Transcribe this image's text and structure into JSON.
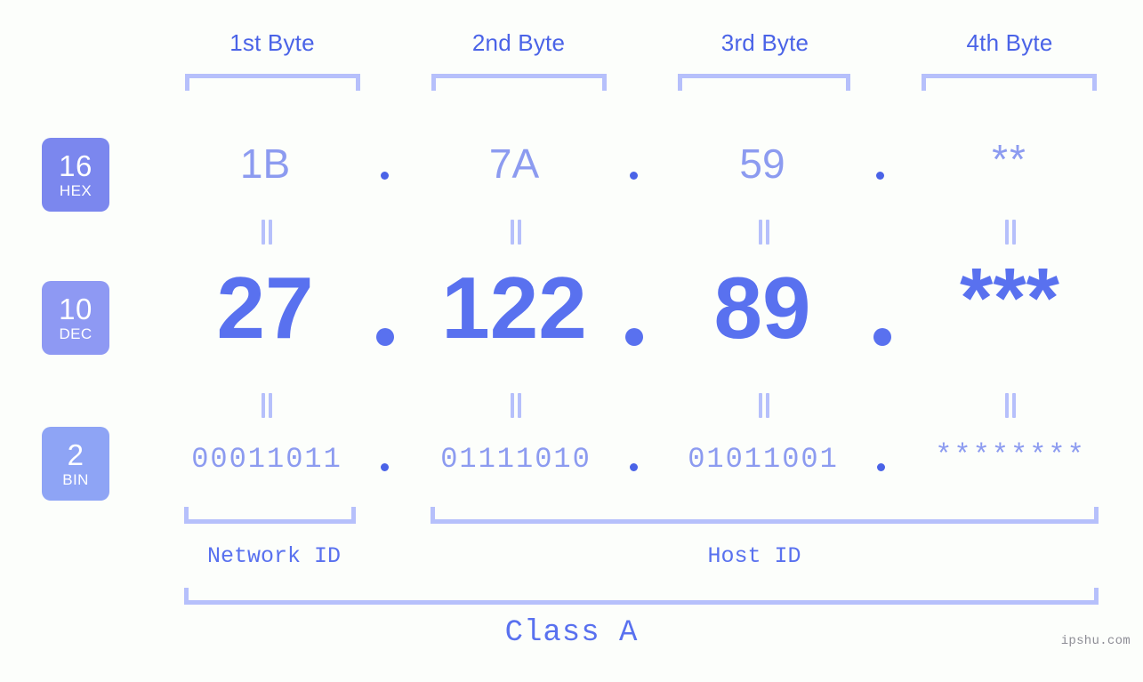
{
  "meta": {
    "background_color": "#fcfefb",
    "accent_color": "#5971ef",
    "light_accent_color": "#8c9bf0",
    "bracket_color": "#b6c0fb"
  },
  "byte_headers": [
    {
      "label": "1st Byte"
    },
    {
      "label": "2nd Byte"
    },
    {
      "label": "3rd Byte"
    },
    {
      "label": "4th Byte"
    }
  ],
  "bases": [
    {
      "number": "16",
      "name": "HEX",
      "color": "#7b87ee"
    },
    {
      "number": "10",
      "name": "DEC",
      "color": "#8e99f3"
    },
    {
      "number": "2",
      "name": "BIN",
      "color": "#8ea4f5"
    }
  ],
  "rows": {
    "hex": {
      "values": [
        "1B",
        "7A",
        "59",
        "**"
      ],
      "separator": "."
    },
    "dec": {
      "values": [
        "27",
        "122",
        "89",
        "***"
      ],
      "separator": "."
    },
    "bin": {
      "values": [
        "00011011",
        "01111010",
        "01011001",
        "********"
      ],
      "separator": "."
    }
  },
  "equivalence_symbol": "||",
  "id_sections": [
    {
      "label": "Network ID"
    },
    {
      "label": "Host ID"
    }
  ],
  "class": {
    "label": "Class A"
  },
  "watermark": {
    "text": "ipshu.com"
  }
}
